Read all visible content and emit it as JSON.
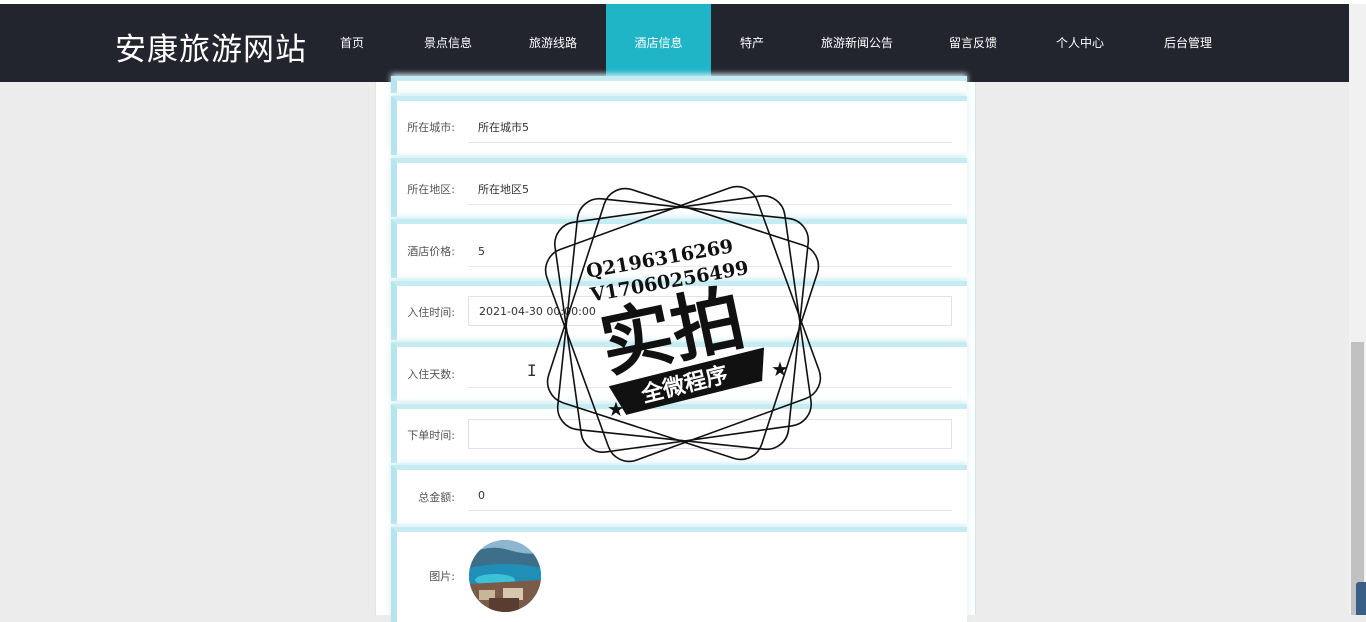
{
  "site": {
    "logo": "安康旅游网站"
  },
  "nav": {
    "items": [
      {
        "label": "首页"
      },
      {
        "label": "景点信息"
      },
      {
        "label": "旅游线路"
      },
      {
        "label": "酒店信息",
        "active": true
      },
      {
        "label": "特产"
      },
      {
        "label": "旅游新闻公告"
      },
      {
        "label": "留言反馈"
      },
      {
        "label": "个人中心"
      },
      {
        "label": "后台管理"
      }
    ]
  },
  "form": {
    "city_label": "所在城市:",
    "city_value": "所在城市5",
    "district_label": "所在地区:",
    "district_value": "所在地区5",
    "price_label": "酒店价格:",
    "price_value": "5",
    "checkin_label": "入住时间:",
    "checkin_value": "2021-04-30 00:00:00",
    "days_label": "入住天数:",
    "days_value": "",
    "order_time_label": "下单时间:",
    "order_time_value": "",
    "total_label": "总金额:",
    "total_value": "0",
    "image_label": "图片:"
  },
  "watermark": {
    "line1": "Q2196316269",
    "line2": "V17060256499",
    "main": "实拍",
    "ribbon": "全微程序"
  },
  "colors": {
    "navbar_bg": "#22242e",
    "nav_active": "#1fb5c7",
    "row_accent": "#b5e4ec"
  }
}
